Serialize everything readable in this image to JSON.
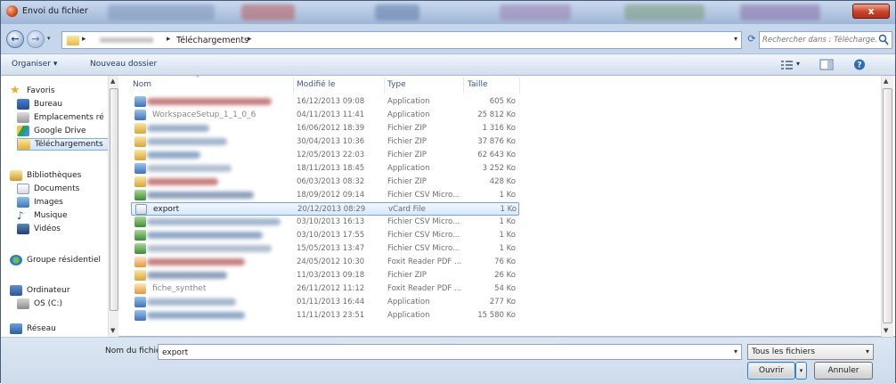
{
  "window": {
    "title": "Envoi du fichier",
    "close_label": "x"
  },
  "address": {
    "current_folder": "Téléchargements",
    "search_placeholder": "Rechercher dans : Télécharge...",
    "sep": "▸"
  },
  "toolbar": {
    "organize_label": "Organiser ▾",
    "new_folder_label": "Nouveau dossier"
  },
  "sidebar": {
    "items": [
      {
        "label": "Favoris",
        "icon": "star-icon"
      },
      {
        "label": "Bureau",
        "icon": "desktop-icon"
      },
      {
        "label": "Emplacements ré",
        "icon": "recent-places-icon"
      },
      {
        "label": "Google Drive",
        "icon": "google-drive-icon"
      },
      {
        "label": "Téléchargements",
        "icon": "downloads-icon"
      },
      {
        "label": "Bibliothèques",
        "icon": "libraries-icon"
      },
      {
        "label": "Documents",
        "icon": "documents-icon"
      },
      {
        "label": "Images",
        "icon": "images-icon"
      },
      {
        "label": "Musique",
        "icon": "music-icon"
      },
      {
        "label": "Vidéos",
        "icon": "videos-icon"
      },
      {
        "label": "Groupe résidentiel",
        "icon": "homegroup-icon"
      },
      {
        "label": "Ordinateur",
        "icon": "computer-icon"
      },
      {
        "label": "OS (C:)",
        "icon": "drive-icon"
      },
      {
        "label": "Réseau",
        "icon": "network-icon"
      }
    ]
  },
  "columns": {
    "name": "Nom",
    "modified": "Modifié le",
    "type": "Type",
    "size": "Taille"
  },
  "files": [
    {
      "name": "",
      "date": "16/12/2013 09:08",
      "type": "Application",
      "size": "605 Ko"
    },
    {
      "name": "WorkspaceSetup_1_1_0_6",
      "date": "04/11/2013 11:41",
      "type": "Application",
      "size": "25 812 Ko"
    },
    {
      "name": "",
      "date": "16/06/2012 18:39",
      "type": "Fichier ZIP",
      "size": "1 316 Ko"
    },
    {
      "name": "",
      "date": "30/04/2013 10:36",
      "type": "Fichier ZIP",
      "size": "37 876 Ko"
    },
    {
      "name": "",
      "date": "12/05/2013 22:03",
      "type": "Fichier ZIP",
      "size": "62 643 Ko"
    },
    {
      "name": "",
      "date": "18/11/2013 18:45",
      "type": "Application",
      "size": "3 252 Ko"
    },
    {
      "name": "",
      "date": "06/03/2013 08:32",
      "type": "Fichier ZIP",
      "size": "428 Ko"
    },
    {
      "name": "",
      "date": "18/09/2012 09:14",
      "type": "Fichier CSV Micro...",
      "size": "1 Ko"
    },
    {
      "name": "export",
      "date": "20/12/2013 08:29",
      "type": "vCard File",
      "size": "1 Ko"
    },
    {
      "name": "",
      "date": "03/10/2013 16:13",
      "type": "Fichier CSV Micro...",
      "size": "1 Ko"
    },
    {
      "name": "",
      "date": "03/10/2013 17:55",
      "type": "Fichier CSV Micro...",
      "size": "1 Ko"
    },
    {
      "name": "",
      "date": "15/05/2013 13:47",
      "type": "Fichier CSV Micro...",
      "size": "1 Ko"
    },
    {
      "name": "",
      "date": "24/05/2012 10:30",
      "type": "Foxit Reader PDF ...",
      "size": "76 Ko"
    },
    {
      "name": "",
      "date": "11/03/2013 09:18",
      "type": "Fichier ZIP",
      "size": "26 Ko"
    },
    {
      "name": "fiche_synthet",
      "date": "26/11/2012 11:12",
      "type": "Foxit Reader PDF ...",
      "size": "54 Ko"
    },
    {
      "name": "",
      "date": "01/11/2013 16:44",
      "type": "Application",
      "size": "277 Ko"
    },
    {
      "name": "",
      "date": "11/11/2013 23:51",
      "type": "Application",
      "size": "15 580 Ko"
    }
  ],
  "bottom": {
    "filename_label": "Nom du fichier :",
    "filename_value": "export",
    "filter_value": "Tous les fichiers",
    "open_label": "Ouvrir",
    "cancel_label": "Annuler"
  }
}
